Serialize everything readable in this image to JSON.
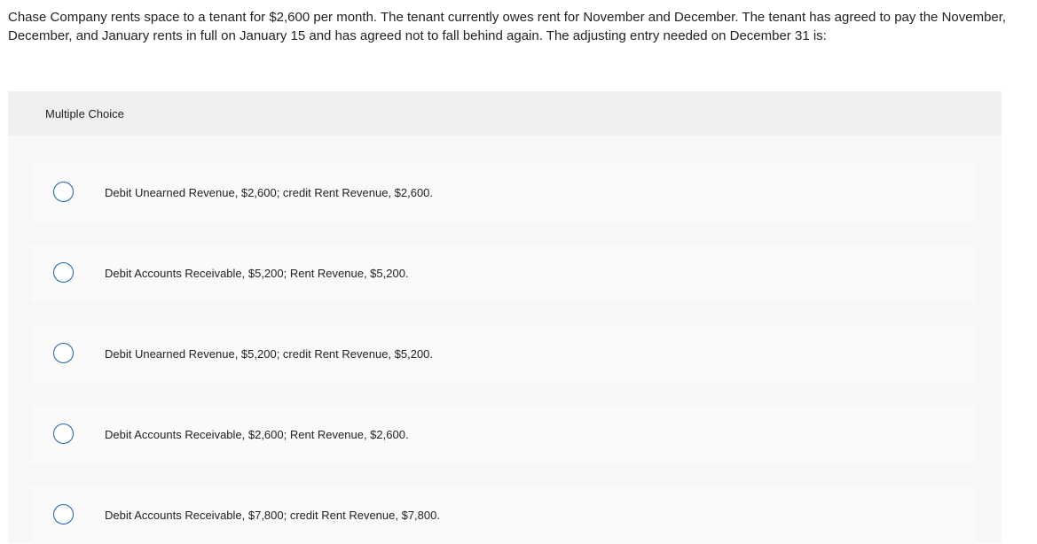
{
  "question": {
    "text": "Chase Company rents space to a tenant for $2,600 per month. The tenant currently owes rent for November and December. The tenant has agreed to pay the November, December, and January rents in full on January 15 and has agreed not to fall behind again. The adjusting entry needed on December 31 is:"
  },
  "panel": {
    "header": "Multiple Choice"
  },
  "choices": [
    {
      "label": "Debit Unearned Revenue, $2,600; credit Rent Revenue, $2,600.",
      "selected": false
    },
    {
      "label": "Debit Accounts Receivable, $5,200; Rent Revenue, $5,200.",
      "selected": false
    },
    {
      "label": "Debit Unearned Revenue, $5,200; credit Rent Revenue, $5,200.",
      "selected": false
    },
    {
      "label": "Debit Accounts Receivable, $2,600; Rent Revenue, $2,600.",
      "selected": false
    },
    {
      "label": "Debit Accounts Receivable, $7,800; credit Rent Revenue, $7,800.",
      "selected": false
    }
  ],
  "colors": {
    "radio_border": "#1c5fb8",
    "panel_bg": "#f7f7f7",
    "header_bg": "#efefef"
  }
}
